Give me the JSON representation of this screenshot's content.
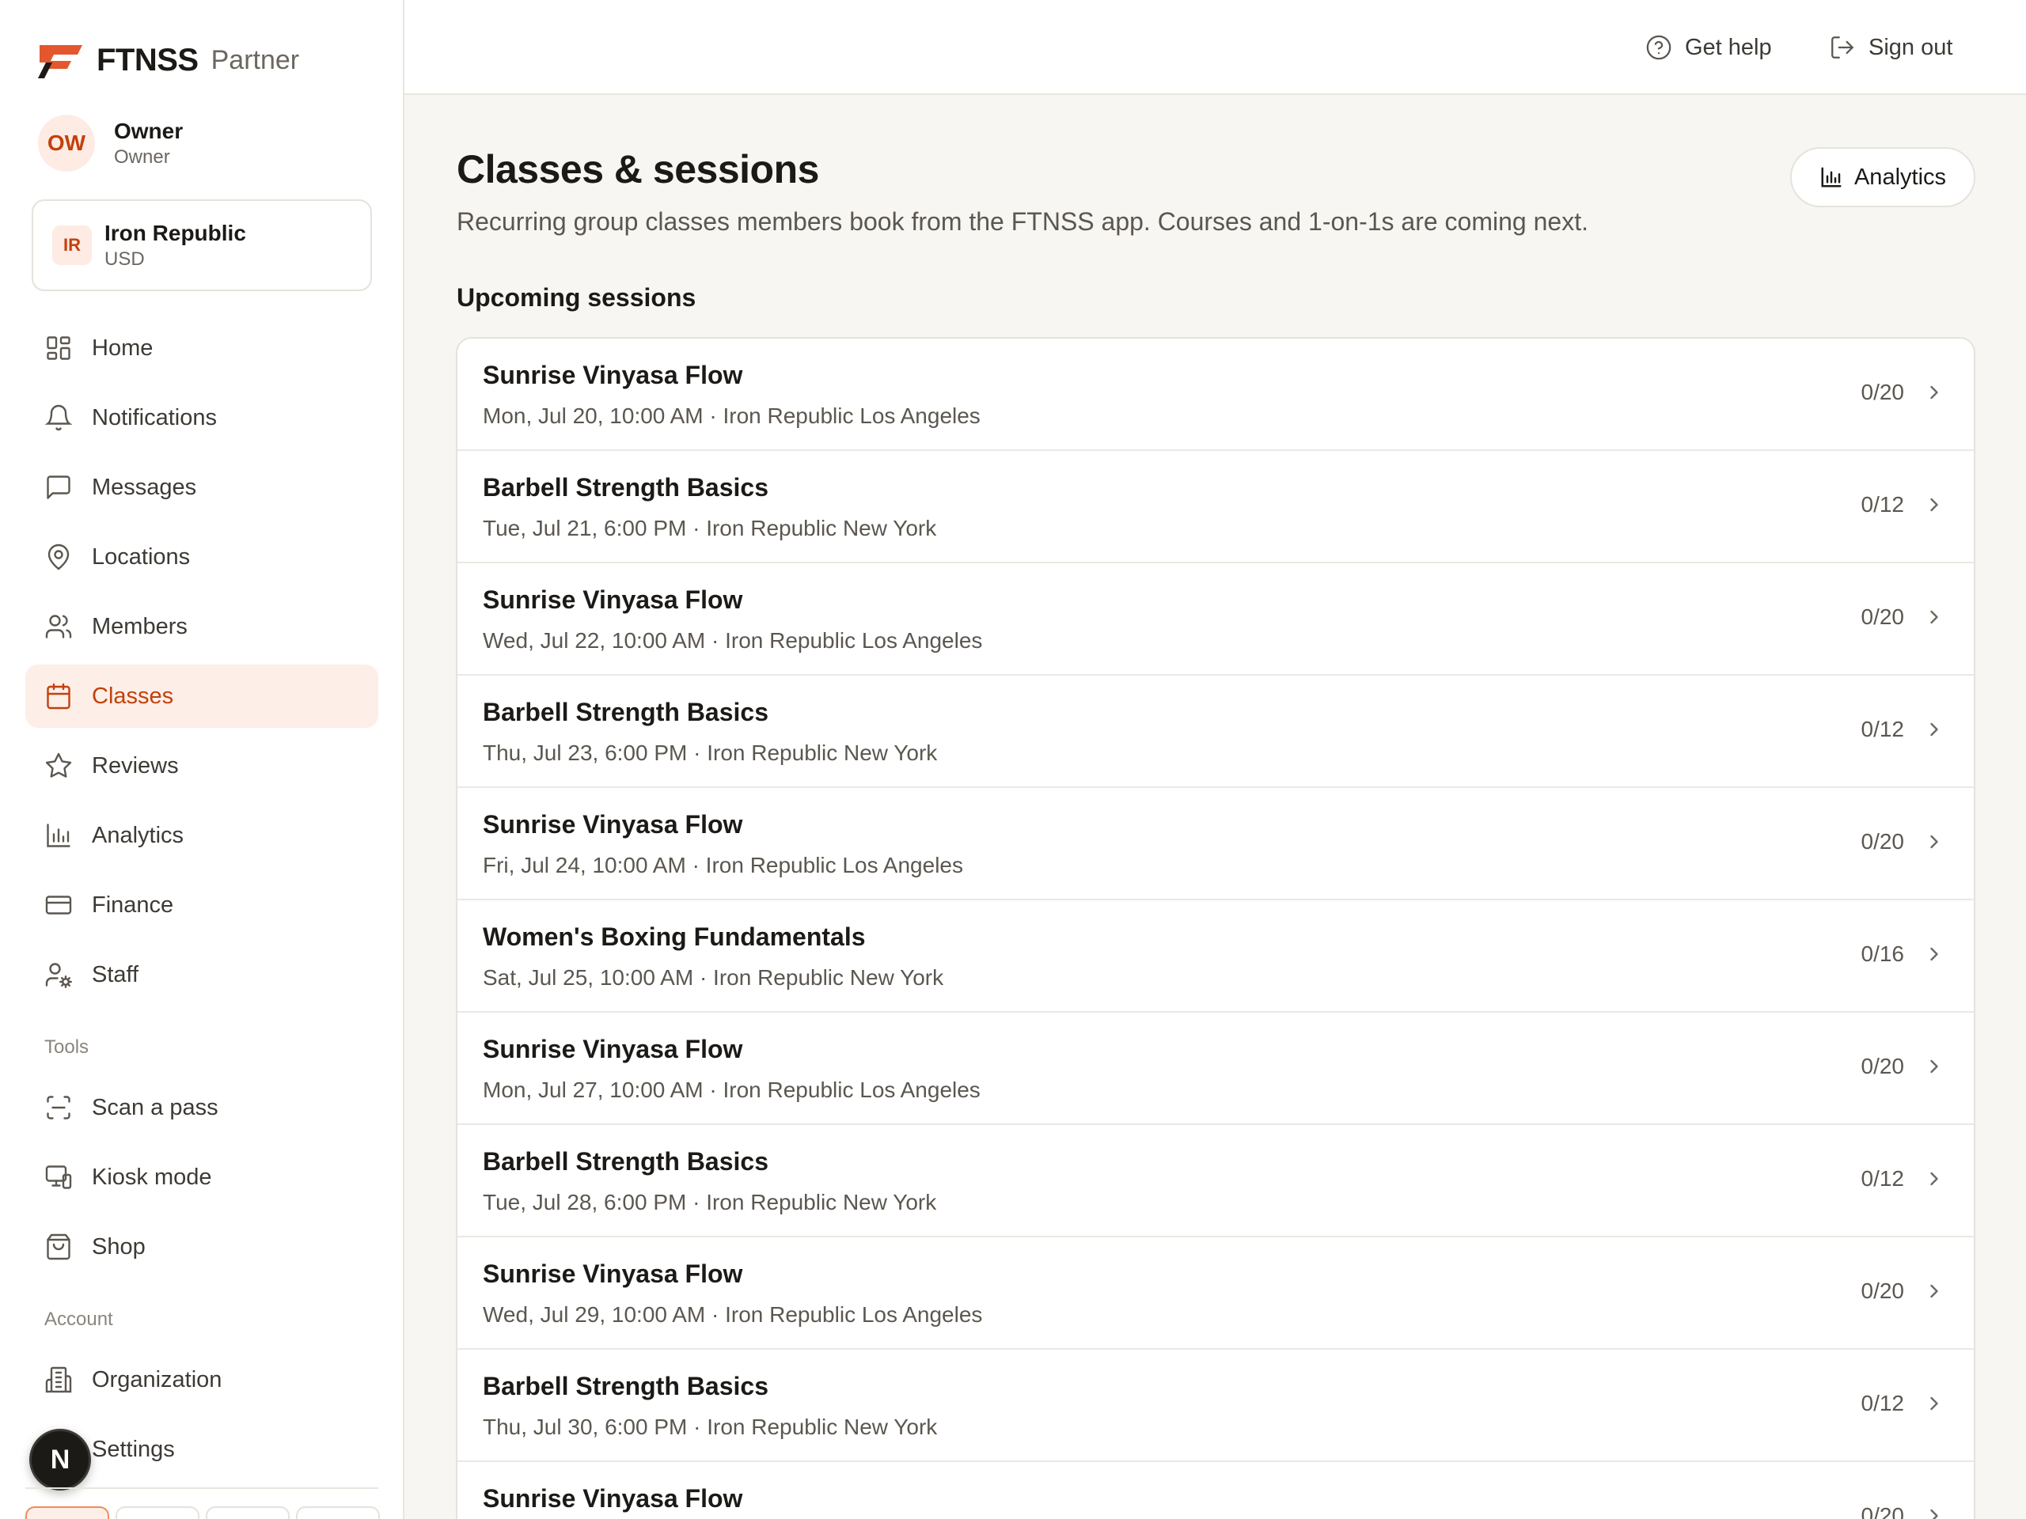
{
  "brand": {
    "name": "FTNSS",
    "suffix": "Partner",
    "logo_icon": "ftnss-logo-icon",
    "accent_color": "#e4572e"
  },
  "user": {
    "initials": "OW",
    "name": "Owner",
    "role": "Owner"
  },
  "organization": {
    "initials": "IR",
    "name": "Iron Republic",
    "currency": "USD"
  },
  "nav": {
    "main": [
      {
        "id": "home",
        "label": "Home",
        "icon": "grid-icon",
        "active": false
      },
      {
        "id": "notifications",
        "label": "Notifications",
        "icon": "bell-icon",
        "active": false
      },
      {
        "id": "messages",
        "label": "Messages",
        "icon": "message-icon",
        "active": false
      },
      {
        "id": "locations",
        "label": "Locations",
        "icon": "map-pin-icon",
        "active": false
      },
      {
        "id": "members",
        "label": "Members",
        "icon": "users-icon",
        "active": false
      },
      {
        "id": "classes",
        "label": "Classes",
        "icon": "calendar-icon",
        "active": true
      },
      {
        "id": "reviews",
        "label": "Reviews",
        "icon": "star-icon",
        "active": false
      },
      {
        "id": "analytics",
        "label": "Analytics",
        "icon": "bar-chart-icon",
        "active": false
      },
      {
        "id": "finance",
        "label": "Finance",
        "icon": "credit-card-icon",
        "active": false
      },
      {
        "id": "staff",
        "label": "Staff",
        "icon": "user-cog-icon",
        "active": false
      }
    ],
    "tools_label": "Tools",
    "tools": [
      {
        "id": "scan",
        "label": "Scan a pass",
        "icon": "scan-icon"
      },
      {
        "id": "kiosk",
        "label": "Kiosk mode",
        "icon": "monitor-icon"
      },
      {
        "id": "shop",
        "label": "Shop",
        "icon": "shopping-bag-icon"
      }
    ],
    "account_label": "Account",
    "account": [
      {
        "id": "organization",
        "label": "Organization",
        "icon": "building-icon"
      },
      {
        "id": "settings",
        "label": "Settings",
        "icon": "gear-icon"
      }
    ]
  },
  "dev_badge": {
    "label": "N"
  },
  "header": {
    "help_label": "Get help",
    "signout_label": "Sign out"
  },
  "page": {
    "title": "Classes & sessions",
    "description": "Recurring group classes members book from the FTNSS app. Courses and 1-on-1s are coming next.",
    "analytics_button": "Analytics",
    "section_title": "Upcoming sessions"
  },
  "sessions": [
    {
      "title": "Sunrise Vinyasa Flow",
      "when": "Mon, Jul 20, 10:00 AM · Iron Republic Los Angeles",
      "capacity": "0/20"
    },
    {
      "title": "Barbell Strength Basics",
      "when": "Tue, Jul 21, 6:00 PM · Iron Republic New York",
      "capacity": "0/12"
    },
    {
      "title": "Sunrise Vinyasa Flow",
      "when": "Wed, Jul 22, 10:00 AM · Iron Republic Los Angeles",
      "capacity": "0/20"
    },
    {
      "title": "Barbell Strength Basics",
      "when": "Thu, Jul 23, 6:00 PM · Iron Republic New York",
      "capacity": "0/12"
    },
    {
      "title": "Sunrise Vinyasa Flow",
      "when": "Fri, Jul 24, 10:00 AM · Iron Republic Los Angeles",
      "capacity": "0/20"
    },
    {
      "title": "Women's Boxing Fundamentals",
      "when": "Sat, Jul 25, 10:00 AM · Iron Republic New York",
      "capacity": "0/16"
    },
    {
      "title": "Sunrise Vinyasa Flow",
      "when": "Mon, Jul 27, 10:00 AM · Iron Republic Los Angeles",
      "capacity": "0/20"
    },
    {
      "title": "Barbell Strength Basics",
      "when": "Tue, Jul 28, 6:00 PM · Iron Republic New York",
      "capacity": "0/12"
    },
    {
      "title": "Sunrise Vinyasa Flow",
      "when": "Wed, Jul 29, 10:00 AM · Iron Republic Los Angeles",
      "capacity": "0/20"
    },
    {
      "title": "Barbell Strength Basics",
      "when": "Thu, Jul 30, 6:00 PM · Iron Republic New York",
      "capacity": "0/12"
    },
    {
      "title": "Sunrise Vinyasa Flow",
      "when": "",
      "capacity": "0/20"
    }
  ]
}
